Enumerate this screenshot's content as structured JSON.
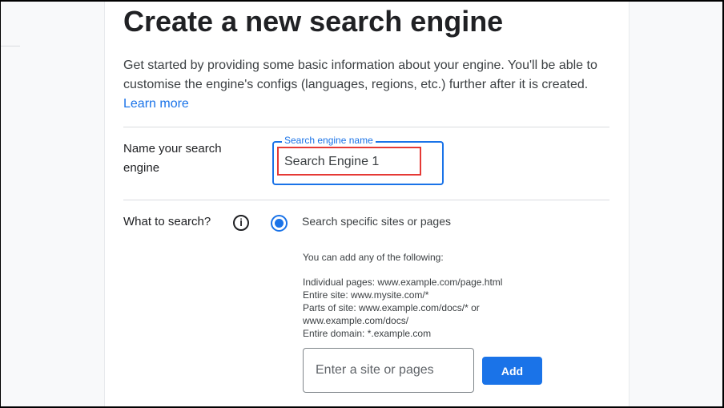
{
  "page": {
    "title": "Create a new search engine",
    "description": "Get started by providing some basic information about your engine. You'll be able to customise the engine's configs (languages, regions, etc.) further after it is created.",
    "learn_more": "Learn more"
  },
  "name_section": {
    "label": "Name your search engine",
    "field_label": "Search engine name",
    "field_value": "Search Engine 1"
  },
  "search_section": {
    "label": "What to search?",
    "info_icon": "i",
    "radio_label": "Search specific sites or pages",
    "help_intro": "You can add any of the following:",
    "help_lines": [
      "Individual pages: www.example.com/page.html",
      "Entire site: www.mysite.com/*",
      "Parts of site: www.example.com/docs/* or",
      "www.example.com/docs/",
      "Entire domain: *.example.com"
    ],
    "site_placeholder": "Enter a site or pages",
    "add_label": "Add"
  }
}
